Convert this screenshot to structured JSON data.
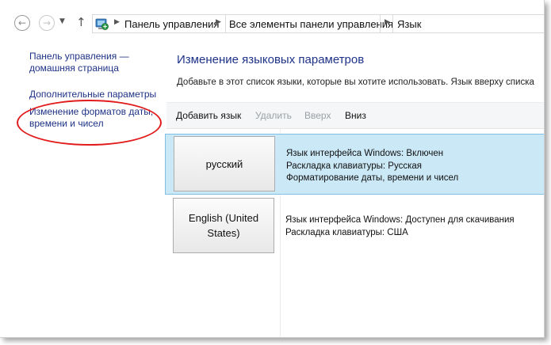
{
  "nav": {
    "back_glyph": "←",
    "forward_glyph": "→",
    "dropdown_glyph": "▼",
    "up_glyph": "↑",
    "breadcrumb": [
      {
        "label": "Панель управления"
      },
      {
        "label": "Все элементы панели управления"
      },
      {
        "label": "Язык"
      }
    ],
    "separator_glyph": "▶"
  },
  "sidebar": {
    "home_link": [
      "Панель управления —",
      "домашняя страница"
    ],
    "advanced_link": "Дополнительные параметры",
    "formats_link": [
      "Изменение форматов даты,",
      "времени и чисел"
    ],
    "highlight_color": "#e21c1c"
  },
  "main": {
    "title": "Изменение языковых параметров",
    "description": "Добавьте в этот список языки, которые вы хотите использовать. Язык вверху списка",
    "toolbar": {
      "add": "Добавить язык",
      "remove": "Удалить",
      "up": "Вверх",
      "down": "Вниз"
    },
    "languages": [
      {
        "name": [
          "русский"
        ],
        "details": [
          "Язык интерфейса Windows: Включен",
          "Раскладка клавиатуры: Русская",
          "Форматирование даты, времени и чисел"
        ]
      },
      {
        "name": [
          "English (United",
          "States)"
        ],
        "details": [
          "Язык интерфейса Windows: Доступен для скачивания",
          "Раскладка клавиатуры: США"
        ]
      }
    ]
  },
  "colors": {
    "link": "#1e3287",
    "selected_row": "#cbe8f6",
    "selected_border": "#7fc0e4",
    "disabled_text": "#9aa0a6"
  }
}
